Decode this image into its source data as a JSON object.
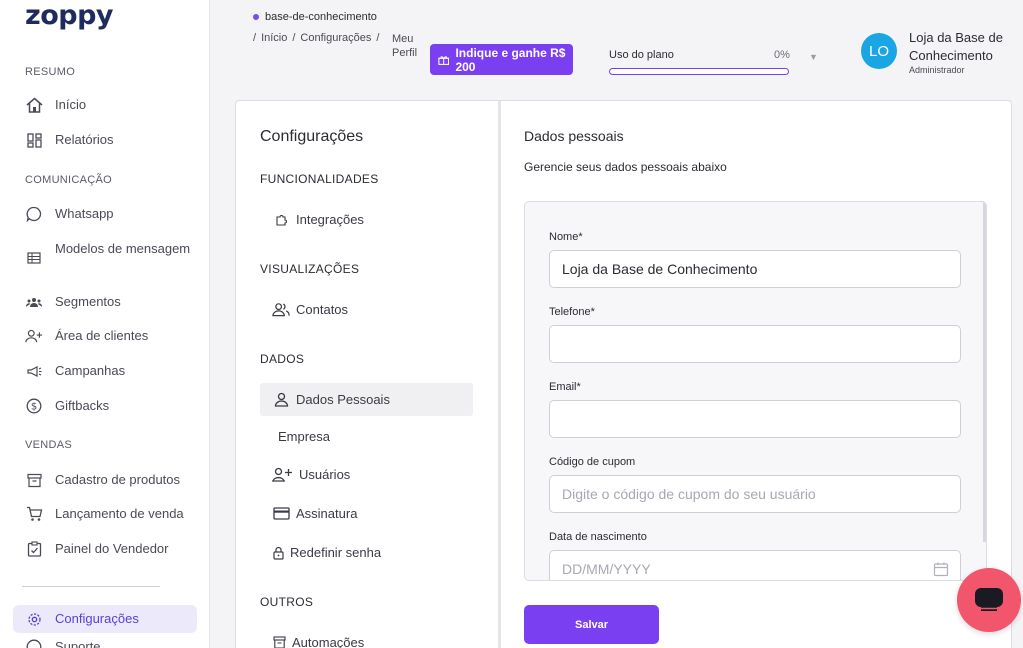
{
  "brand": {
    "logo": "zoppy"
  },
  "sidebar": {
    "sections": {
      "resumo": "RESUMO",
      "comunicacao": "COMUNICAÇÃO",
      "vendas": "VENDAS"
    },
    "items": {
      "inicio": "Início",
      "relatorios": "Relatórios",
      "whatsapp": "Whatsapp",
      "modelos": "Modelos de mensagem",
      "segmentos": "Segmentos",
      "area_clientes": "Área de clientes",
      "campanhas": "Campanhas",
      "giftbacks": "Giftbacks",
      "cadastro_produtos": "Cadastro de produtos",
      "lancamento_venda": "Lançamento de venda",
      "painel_vendedor": "Painel do Vendedor",
      "configuracoes": "Configurações",
      "suporte": "Suporte"
    }
  },
  "header": {
    "store_tag": "base-de-conhecimento",
    "breadcrumbs": [
      "/",
      "Início",
      "/",
      "Configurações",
      "/"
    ],
    "breadcrumb_last": "Meu Perfil",
    "promo_label": "Indique e ganhe R$ 200",
    "plan_label": "Uso do plano",
    "plan_percent": "0%",
    "plan_fraction": 0,
    "user_initials": "LO",
    "user_name": "Loja da Base de Conhecimento",
    "user_role": "Administrador"
  },
  "settings": {
    "title": "Configurações",
    "groups": {
      "funcionalidades": "FUNCIONALIDADES",
      "visualizacoes": "VISUALIZAÇÕES",
      "dados": "DADOS",
      "outros": "OUTROS"
    },
    "items": {
      "integracoes": "Integrações",
      "contatos": "Contatos",
      "dados_pessoais": "Dados Pessoais",
      "empresa": "Empresa",
      "usuarios": "Usuários",
      "assinatura": "Assinatura",
      "redefinir_senha": "Redefinir senha",
      "automacoes": "Automações"
    }
  },
  "form": {
    "title": "Dados pessoais",
    "subtitle": "Gerencie seus dados pessoais abaixo",
    "nome_label": "Nome*",
    "nome_value": "Loja da Base de Conhecimento",
    "telefone_label": "Telefone*",
    "telefone_value": "",
    "email_label": "Email*",
    "email_value": "",
    "cupom_label": "Código de cupom",
    "cupom_placeholder": "Digite o código de cupom do seu usuário",
    "nascimento_label": "Data de nascimento",
    "nascimento_placeholder": "DD/MM/YYYY",
    "save_label": "Salvar"
  },
  "colors": {
    "accent": "#7b3ff2",
    "chat": "#f2566c",
    "avatar": "#1aa6e4"
  }
}
